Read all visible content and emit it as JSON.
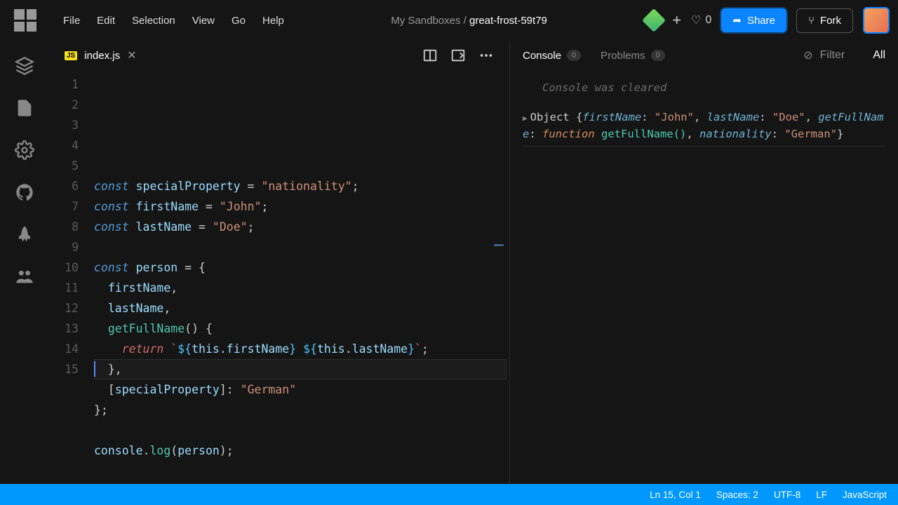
{
  "menubar": {
    "items": [
      "File",
      "Edit",
      "Selection",
      "View",
      "Go",
      "Help"
    ]
  },
  "breadcrumb": {
    "parent": "My Sandboxes / ",
    "current": "great-frost-59t79"
  },
  "header": {
    "likes": "0",
    "share": "Share",
    "fork": "Fork"
  },
  "tab": {
    "badge": "JS",
    "filename": "index.js"
  },
  "code": {
    "lines": [
      [
        [
          "kw",
          "const"
        ],
        [
          "punct",
          " "
        ],
        [
          "var",
          "specialProperty"
        ],
        [
          "punct",
          " = "
        ],
        [
          "str",
          "\"nationality\""
        ],
        [
          "punct",
          ";"
        ]
      ],
      [
        [
          "kw",
          "const"
        ],
        [
          "punct",
          " "
        ],
        [
          "var",
          "firstName"
        ],
        [
          "punct",
          " = "
        ],
        [
          "str",
          "\"John\""
        ],
        [
          "punct",
          ";"
        ]
      ],
      [
        [
          "kw",
          "const"
        ],
        [
          "punct",
          " "
        ],
        [
          "var",
          "lastName"
        ],
        [
          "punct",
          " = "
        ],
        [
          "str",
          "\"Doe\""
        ],
        [
          "punct",
          ";"
        ]
      ],
      [],
      [
        [
          "kw",
          "const"
        ],
        [
          "punct",
          " "
        ],
        [
          "var",
          "person"
        ],
        [
          "punct",
          " = {"
        ]
      ],
      [
        [
          "punct",
          "  "
        ],
        [
          "var",
          "firstName"
        ],
        [
          "punct",
          ","
        ]
      ],
      [
        [
          "punct",
          "  "
        ],
        [
          "var",
          "lastName"
        ],
        [
          "punct",
          ","
        ]
      ],
      [
        [
          "punct",
          "  "
        ],
        [
          "fn",
          "getFullName"
        ],
        [
          "punct",
          "() {"
        ]
      ],
      [
        [
          "punct",
          "    "
        ],
        [
          "ret",
          "return"
        ],
        [
          "punct",
          " "
        ],
        [
          "str",
          "`"
        ],
        [
          "tmpl",
          "${"
        ],
        [
          "var",
          "this"
        ],
        [
          "punct",
          "."
        ],
        [
          "var",
          "firstName"
        ],
        [
          "tmpl",
          "}"
        ],
        [
          "str",
          " "
        ],
        [
          "tmpl",
          "${"
        ],
        [
          "var",
          "this"
        ],
        [
          "punct",
          "."
        ],
        [
          "var",
          "lastName"
        ],
        [
          "tmpl",
          "}"
        ],
        [
          "str",
          "`"
        ],
        [
          "punct",
          ";"
        ]
      ],
      [
        [
          "punct",
          "  },"
        ]
      ],
      [
        [
          "punct",
          "  ["
        ],
        [
          "var",
          "specialProperty"
        ],
        [
          "punct",
          "]: "
        ],
        [
          "str",
          "\"German\""
        ]
      ],
      [
        [
          "punct",
          "};"
        ]
      ],
      [],
      [
        [
          "var",
          "console"
        ],
        [
          "punct",
          "."
        ],
        [
          "fn",
          "log"
        ],
        [
          "punct",
          "("
        ],
        [
          "var",
          "person"
        ],
        [
          "punct",
          ");"
        ]
      ],
      []
    ]
  },
  "panel": {
    "tabs": {
      "console": {
        "label": "Console",
        "count": "0"
      },
      "problems": {
        "label": "Problems",
        "count": "0"
      }
    },
    "filter": "Filter",
    "all": "All"
  },
  "console": {
    "cleared": "Console was cleared",
    "output_tokens": [
      [
        "c-obj",
        "Object {"
      ],
      [
        "c-key",
        "firstName"
      ],
      [
        "c-obj",
        ": "
      ],
      [
        "c-str",
        "\"John\""
      ],
      [
        "c-obj",
        ", "
      ],
      [
        "c-key",
        "lastName"
      ],
      [
        "c-obj",
        ": "
      ],
      [
        "c-str",
        "\"Doe\""
      ],
      [
        "c-obj",
        ", "
      ],
      [
        "c-key",
        "getFullName"
      ],
      [
        "c-obj",
        ": "
      ],
      [
        "c-fn",
        "function"
      ],
      [
        "c-obj",
        " "
      ],
      [
        "c-prop",
        "getFullName()"
      ],
      [
        "c-obj",
        ", "
      ],
      [
        "c-key",
        "nationality"
      ],
      [
        "c-obj",
        ": "
      ],
      [
        "c-str",
        "\"German\""
      ],
      [
        "c-obj",
        "}"
      ]
    ]
  },
  "statusbar": {
    "pos": "Ln 15, Col 1",
    "spaces": "Spaces: 2",
    "encoding": "UTF-8",
    "eol": "LF",
    "lang": "JavaScript"
  }
}
